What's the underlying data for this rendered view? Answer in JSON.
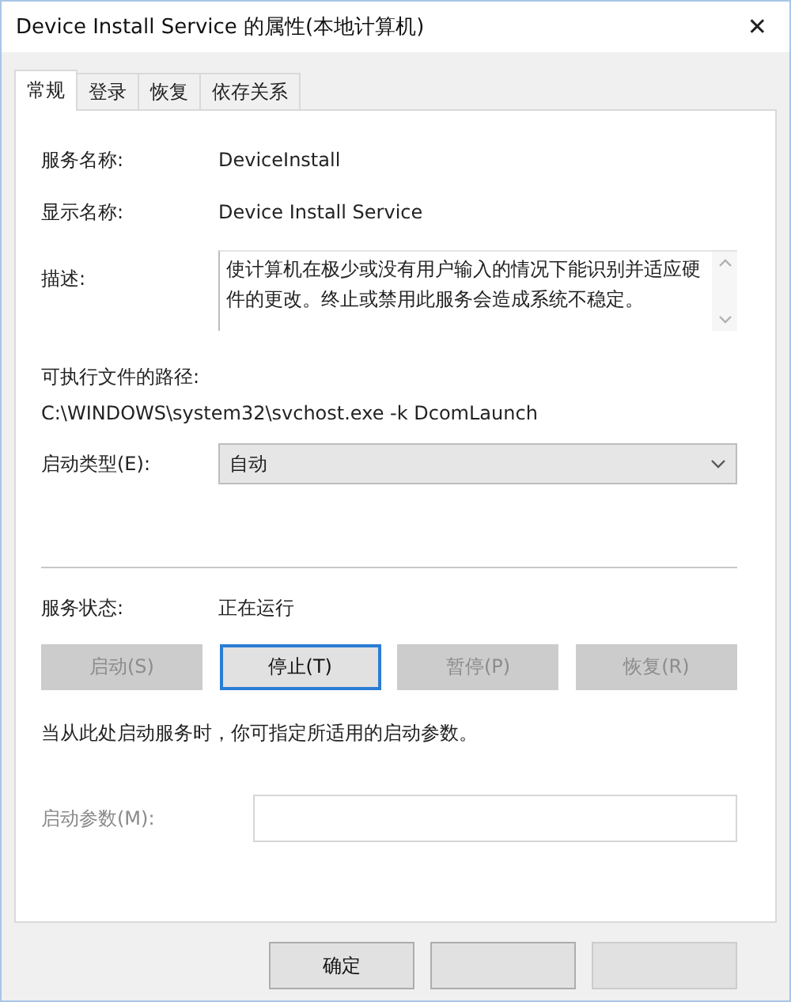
{
  "window": {
    "title": "Device Install Service 的属性(本地计算机)",
    "close": "✕"
  },
  "tabs": [
    {
      "label": "常规",
      "selected": true
    },
    {
      "label": "登录",
      "selected": false
    },
    {
      "label": "恢复",
      "selected": false
    },
    {
      "label": "依存关系",
      "selected": false
    }
  ],
  "fields": [
    {
      "label": "服务名称:",
      "value": "DeviceInstall"
    },
    {
      "label": "显示名称:",
      "value": "Device Install Service"
    }
  ],
  "description": {
    "label": "描述:",
    "value": "使计算机在极少或没有用户输入的情况下能识别并适应硬件的更改。终止或禁用此服务会造成系统不稳定。"
  },
  "path": {
    "label": "可执行文件的路径:",
    "value": "C:\\WINDOWS\\system32\\svchost.exe -k DcomLaunch"
  },
  "startup_type": {
    "label": "启动类型(E):",
    "value": "自动"
  },
  "service_status": {
    "label": "服务状态:",
    "value": "正在运行"
  },
  "service_buttons": [
    {
      "label": "启动(S)",
      "disabled": true,
      "focused": false
    },
    {
      "label": "停止(T)",
      "disabled": false,
      "focused": true
    },
    {
      "label": "暂停(P)",
      "disabled": true,
      "focused": false
    },
    {
      "label": "恢复(R)",
      "disabled": true,
      "focused": false
    }
  ],
  "hint": "当从此处启动服务时，你可指定所适用的启动参数。",
  "start_params": {
    "label": "启动参数(M):",
    "disabled": true
  },
  "dialog_buttons": [
    {
      "label": "确定",
      "disabled": false
    },
    {
      "disabled": false
    },
    {
      "disabled": true
    }
  ]
}
